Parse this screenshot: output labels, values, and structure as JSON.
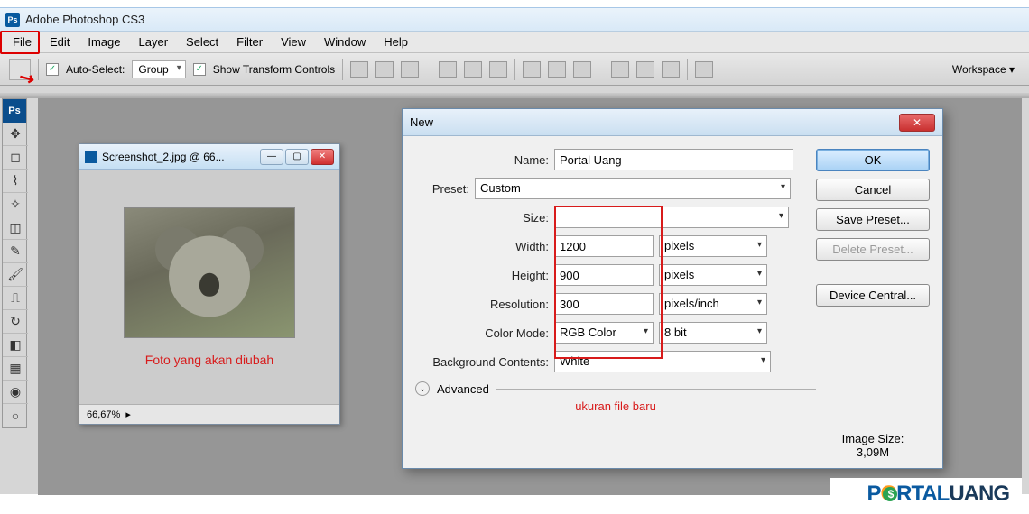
{
  "app": {
    "title": "Adobe Photoshop CS3"
  },
  "menu": {
    "items": [
      "File",
      "Edit",
      "Image",
      "Layer",
      "Select",
      "Filter",
      "View",
      "Window",
      "Help"
    ]
  },
  "options": {
    "auto_select_label": "Auto-Select:",
    "auto_select_value": "Group",
    "show_transform_label": "Show Transform Controls",
    "workspace_label": "Workspace"
  },
  "document": {
    "title": "Screenshot_2.jpg @ 66...",
    "caption": "Foto yang akan diubah",
    "zoom": "66,67%"
  },
  "dialog": {
    "title": "New",
    "name_label": "Name:",
    "name_value": "Portal Uang",
    "preset_label": "Preset:",
    "preset_value": "Custom",
    "size_label": "Size:",
    "width_label": "Width:",
    "width_value": "1200",
    "width_unit": "pixels",
    "height_label": "Height:",
    "height_value": "900",
    "height_unit": "pixels",
    "resolution_label": "Resolution:",
    "resolution_value": "300",
    "resolution_unit": "pixels/inch",
    "color_mode_label": "Color Mode:",
    "color_mode_value": "RGB Color",
    "color_depth_value": "8 bit",
    "bg_contents_label": "Background Contents:",
    "bg_contents_value": "White",
    "advanced_label": "Advanced",
    "annotation": "ukuran file baru",
    "ok": "OK",
    "cancel": "Cancel",
    "save_preset": "Save Preset...",
    "delete_preset": "Delete Preset...",
    "device_central": "Device Central...",
    "image_size_label": "Image Size:",
    "image_size_value": "3,09M"
  },
  "watermark": {
    "p": "P",
    "o": "O",
    "rtal": "RTAL",
    "uang": "UANG"
  }
}
